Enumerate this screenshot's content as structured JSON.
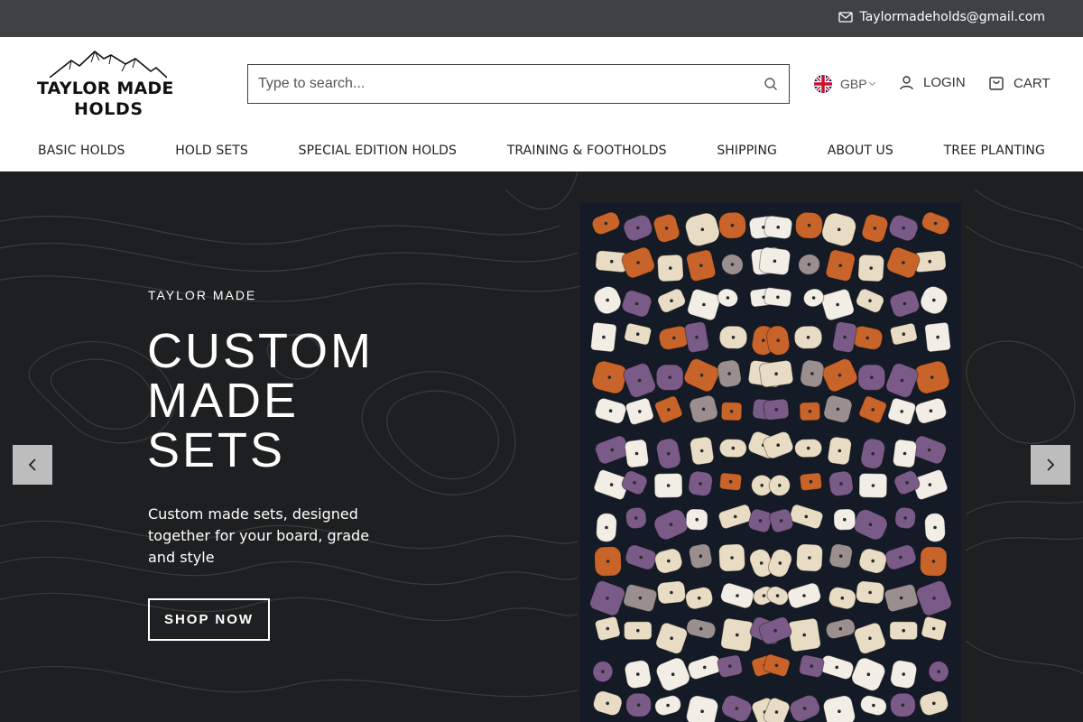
{
  "topbar": {
    "email": "Taylormadeholds@gmail.com",
    "icon": "mail-icon"
  },
  "logo": {
    "line1": "TAYLOR MADE",
    "line2": "HOLDS"
  },
  "search": {
    "placeholder": "Type to search..."
  },
  "currency": {
    "value": "GBP",
    "flag": "uk-flag-icon"
  },
  "account": {
    "login_label": "LOGIN",
    "cart_label": "CART"
  },
  "nav": {
    "items": [
      {
        "label": "BASIC HOLDS"
      },
      {
        "label": "HOLD SETS"
      },
      {
        "label": "SPECIAL EDITION HOLDS"
      },
      {
        "label": "TRAINING & FOOTHOLDS"
      },
      {
        "label": "SHIPPING"
      },
      {
        "label": "ABOUT US"
      },
      {
        "label": "TREE PLANTING"
      }
    ]
  },
  "hero": {
    "eyebrow": "TAYLOR MADE",
    "headline_lines": [
      "CUSTOM",
      "MADE",
      "SETS"
    ],
    "subcopy": "Custom made sets, designed together for your board, grade and style",
    "cta": "SHOP NOW"
  },
  "colors": {
    "topbar": "#3f4142",
    "hero_bg": "#1e1f20",
    "hold_orange": "#c8642a",
    "hold_purple": "#7a5a86",
    "hold_cream": "#e8dcc4",
    "hold_white": "#f2eee6",
    "hold_grey": "#9a8f8e"
  }
}
